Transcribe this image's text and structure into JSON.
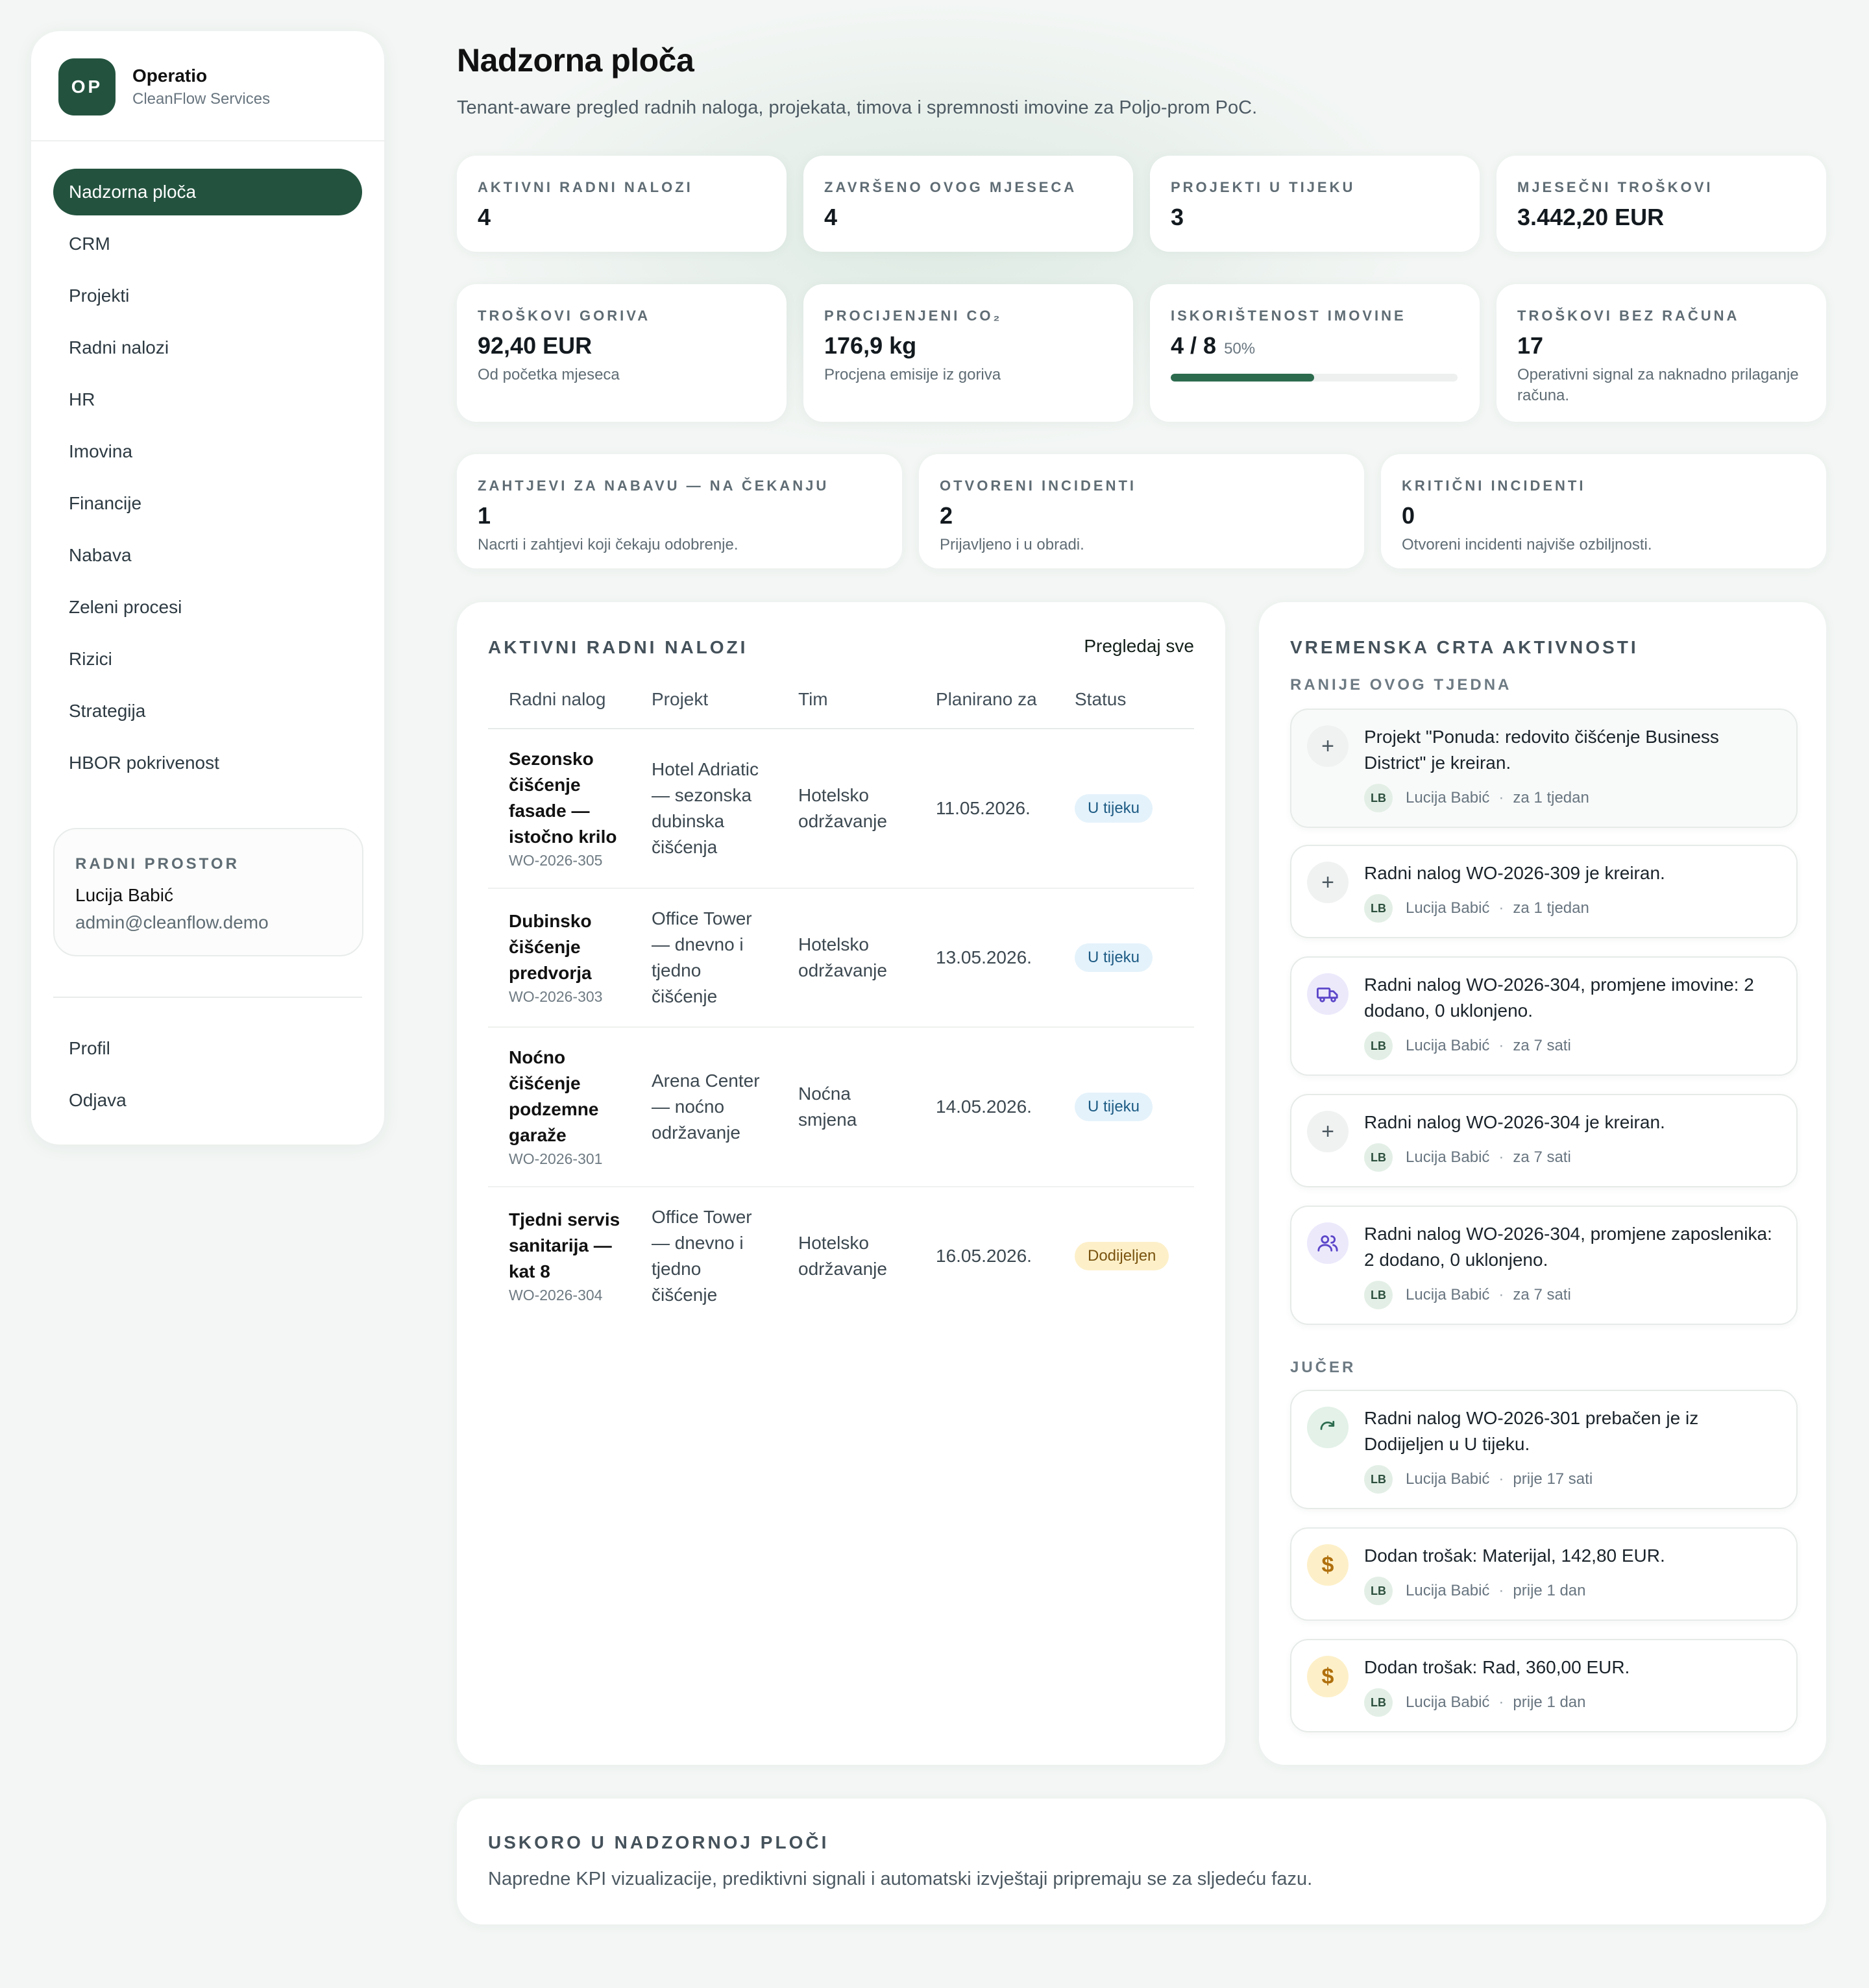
{
  "brand": {
    "logo": "OP",
    "name": "Operatio",
    "subtitle": "CleanFlow Services"
  },
  "nav": {
    "items": [
      {
        "label": "Nadzorna ploča",
        "active": true
      },
      {
        "label": "CRM"
      },
      {
        "label": "Projekti"
      },
      {
        "label": "Radni nalozi"
      },
      {
        "label": "HR"
      },
      {
        "label": "Imovina"
      },
      {
        "label": "Financije"
      },
      {
        "label": "Nabava"
      },
      {
        "label": "Zeleni procesi"
      },
      {
        "label": "Rizici"
      },
      {
        "label": "Strategija"
      },
      {
        "label": "HBOR pokrivenost"
      }
    ],
    "bottom": [
      {
        "label": "Profil"
      },
      {
        "label": "Odjava"
      }
    ]
  },
  "workspace": {
    "label": "RADNI PROSTOR",
    "name": "Lucija Babić",
    "email": "admin@cleanflow.demo"
  },
  "header": {
    "title": "Nadzorna ploča",
    "subtitle": "Tenant-aware pregled radnih naloga, projekata, timova i spremnosti imovine za Poljo-prom PoC."
  },
  "kpis": {
    "row1": [
      {
        "label": "AKTIVNI RADNI NALOZI",
        "value": "4"
      },
      {
        "label": "ZAVRŠENO OVOG MJESECA",
        "value": "4"
      },
      {
        "label": "PROJEKTI U TIJEKU",
        "value": "3"
      },
      {
        "label": "MJESEČNI TROŠKOVI",
        "value": "3.442,20 EUR"
      }
    ],
    "row2": [
      {
        "label": "TROŠKOVI GORIVA",
        "value": "92,40 EUR",
        "note": "Od početka mjeseca"
      },
      {
        "label": "PROCIJENJENI CO₂",
        "value": "176,9 kg",
        "note": "Procjena emisije iz goriva"
      },
      {
        "label": "ISKORIŠTENOST IMOVINE",
        "value": "4 / 8",
        "pct": "50%",
        "progress": 0.5
      },
      {
        "label": "TROŠKOVI BEZ RAČUNA",
        "value": "17",
        "note": "Operativni signal za naknadno prilaganje računa."
      }
    ],
    "row3": [
      {
        "label": "ZAHTJEVI ZA NABAVU — NA ČEKANJU",
        "value": "1",
        "note": "Nacrti i zahtjevi koji čekaju odobrenje."
      },
      {
        "label": "OTVORENI INCIDENTI",
        "value": "2",
        "note": "Prijavljeno i u obradi."
      },
      {
        "label": "KRITIČNI INCIDENTI",
        "value": "0",
        "note": "Otvoreni incidenti najviše ozbiljnosti."
      }
    ]
  },
  "work_orders": {
    "title": "AKTIVNI RADNI NALOZI",
    "view_all": "Pregledaj sve",
    "columns": [
      "Radni nalog",
      "Projekt",
      "Tim",
      "Planirano za",
      "Status"
    ],
    "rows": [
      {
        "name": "Sezonsko čišćenje fasade — istočno krilo",
        "code": "WO-2026-305",
        "project": "Hotel Adriatic — sezonska dubinska čišćenja",
        "team": "Hotelsko održavanje",
        "planned": "11.05.2026.",
        "status": "U tijeku",
        "status_color": "blue"
      },
      {
        "name": "Dubinsko čišćenje predvorja",
        "code": "WO-2026-303",
        "project": "Office Tower — dnevno i tjedno čišćenje",
        "team": "Hotelsko održavanje",
        "planned": "13.05.2026.",
        "status": "U tijeku",
        "status_color": "blue"
      },
      {
        "name": "Noćno čišćenje podzemne garaže",
        "code": "WO-2026-301",
        "project": "Arena Center — noćno održavanje",
        "team": "Noćna smjena",
        "planned": "14.05.2026.",
        "status": "U tijeku",
        "status_color": "blue"
      },
      {
        "name": "Tjedni servis sanitarija — kat 8",
        "code": "WO-2026-304",
        "project": "Office Tower — dnevno i tjedno čišćenje",
        "team": "Hotelsko održavanje",
        "planned": "16.05.2026.",
        "status": "Dodijeljen",
        "status_color": "yellow"
      }
    ]
  },
  "timeline": {
    "title": "VREMENSKA CRTA AKTIVNOSTI",
    "sections": [
      {
        "label": "RANIJE OVOG TJEDNA",
        "items": [
          {
            "icon": "plus-icon",
            "text": "Projekt \"Ponuda: redovito čišćenje Business District\" je kreiran.",
            "initials": "LB",
            "user": "Lucija Babić",
            "time": "za 1 tjedan"
          },
          {
            "icon": "plus-icon",
            "text": "Radni nalog WO-2026-309 je kreiran.",
            "initials": "LB",
            "user": "Lucija Babić",
            "time": "za 1 tjedan"
          },
          {
            "icon": "truck-icon",
            "text": "Radni nalog WO-2026-304, promjene imovine: 2 dodano, 0 uklonjeno.",
            "initials": "LB",
            "user": "Lucija Babić",
            "time": "za 7 sati"
          },
          {
            "icon": "plus-icon",
            "text": "Radni nalog WO-2026-304 je kreiran.",
            "initials": "LB",
            "user": "Lucija Babić",
            "time": "za 7 sati"
          },
          {
            "icon": "users-icon",
            "text": "Radni nalog WO-2026-304, promjene zaposlenika: 2 dodano, 0 uklonjeno.",
            "initials": "LB",
            "user": "Lucija Babić",
            "time": "za 7 sati"
          }
        ]
      },
      {
        "label": "JUČER",
        "items": [
          {
            "icon": "refresh-icon",
            "text": "Radni nalog WO-2026-301 prebačen je iz Dodijeljen u U tijeku.",
            "initials": "LB",
            "user": "Lucija Babić",
            "time": "prije 17 sati"
          },
          {
            "icon": "dollar-icon",
            "text": "Dodan trošak: Materijal, 142,80 EUR.",
            "initials": "LB",
            "user": "Lucija Babić",
            "time": "prije 1 dan"
          },
          {
            "icon": "dollar-icon",
            "text": "Dodan trošak: Rad, 360,00 EUR.",
            "initials": "LB",
            "user": "Lucija Babić",
            "time": "prije 1 dan"
          }
        ]
      }
    ]
  },
  "coming_soon": {
    "title": "USKORO U NADZORNOJ PLOČI",
    "text": "Napredne KPI vizualizacije, prediktivni signali i automatski izvještaji pripremaju se za sljedeću fazu."
  },
  "colors": {
    "accent": "#23533f",
    "progress": "#2c6b4e",
    "badge_blue": "#e4f2fb",
    "badge_yellow": "#fdf0c9"
  }
}
